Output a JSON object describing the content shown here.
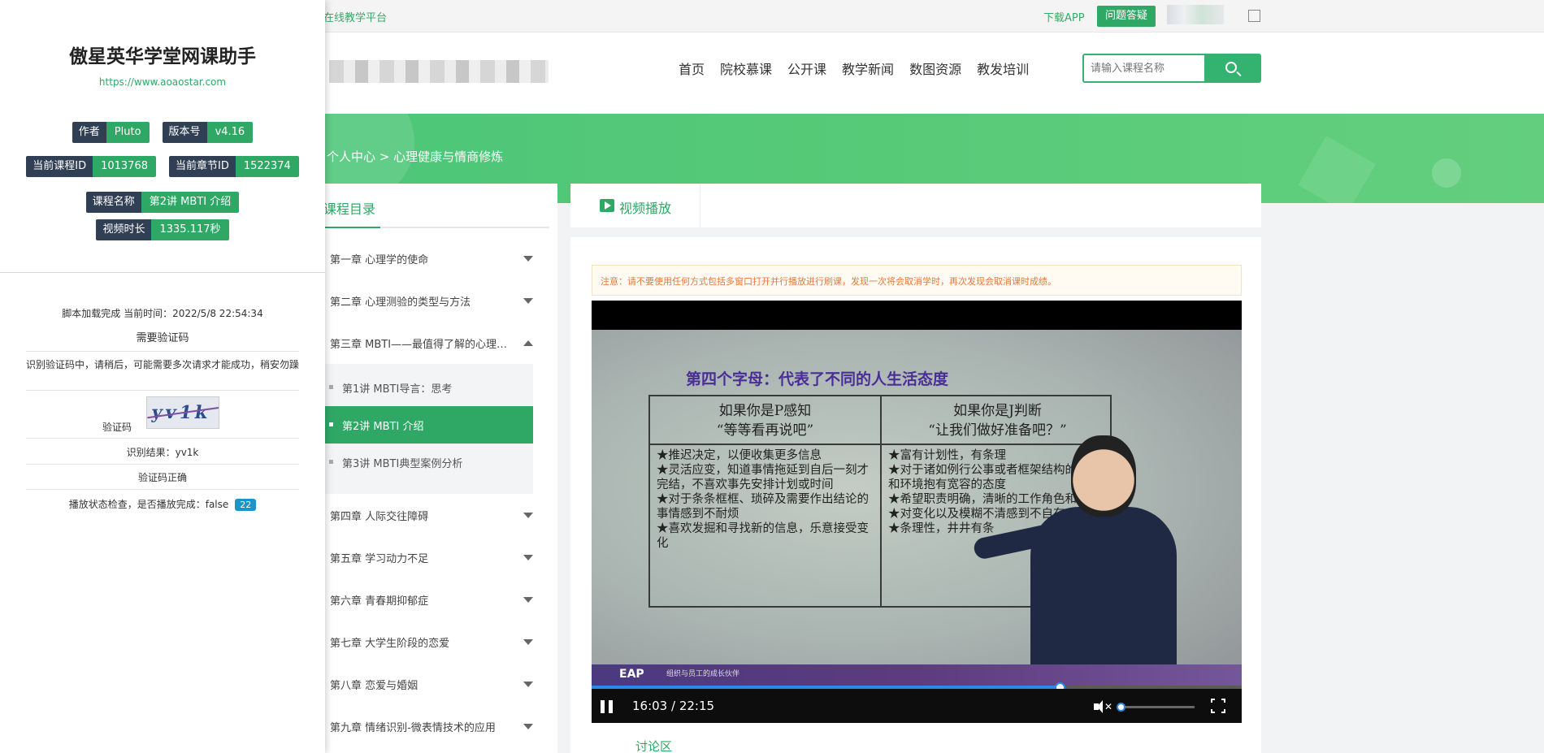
{
  "topbar": {
    "platform": "在线教学平台",
    "download": "下载APP",
    "qa": "问题答疑"
  },
  "nav": {
    "items": [
      "首页",
      "院校慕课",
      "公开课",
      "教学新闻",
      "数图资源",
      "教发培训"
    ],
    "search_placeholder": "请输入课程名称"
  },
  "breadcrumb": "个人中心 > 心理健康与情商修炼",
  "catalog": {
    "title": "课程目录",
    "chapters": [
      "第一章 心理学的使命",
      "第二章 心理测验的类型与方法",
      "第三章 MBTI——最值得了解的心理测验",
      "第四章 人际交往障碍",
      "第五章 学习动力不足",
      "第六章 青春期抑郁症",
      "第七章 大学生阶段的恋爱",
      "第八章 恋爱与婚姻",
      "第九章 情绪识别-微表情技术的应用"
    ],
    "lessons": [
      "第1讲 MBTI导言：思考",
      "第2讲 MBTI 介绍",
      "第3讲 MBTI典型案例分析"
    ],
    "active_lesson": 1
  },
  "player": {
    "tab": "视频播放",
    "notice": "注意：请不要使用任何方式包括多窗口打开并行播放进行刷课，发现一次将会取消学时，再次发现会取消课时成绩。",
    "time": "16:03 / 22:15",
    "progress": 0.72,
    "volume": 0.0,
    "discussion": "讨论区"
  },
  "slide": {
    "title": "第四个字母：代表了不同的人生活态度",
    "left_head_1": "如果你是P感知",
    "left_head_2": "“等等看再说吧”",
    "right_head_1": "如果你是J判断",
    "right_head_2": "“让我们做好准备吧？”",
    "left_items": [
      "★推迟决定，以便收集更多信息",
      "★灵活应变，知道事情拖延到自后一刻才完结，不喜欢事先安排计划或时间",
      "★对于条条框框、琐碎及需要作出结论的事情感到不耐烦",
      "★喜欢发掘和寻找新的信息，乐意接受变化"
    ],
    "right_items": [
      "★富有计划性，有条理",
      "★对于诸如例行公事或者框架结构的事务和环境抱有宽容的态度",
      "★希望职责明确，清晰的工作角色和任务",
      "★对变化以及模糊不清感到不自在",
      "★条理性，井井有条"
    ],
    "footer_logo": "EAP",
    "footer_text": "组织与员工的成长伙伴"
  },
  "helper": {
    "title": "傲星英华学堂网课助手",
    "url": "https://www.aoaostar.com",
    "author_k": "作者",
    "author_v": "Pluto",
    "version_k": "版本号",
    "version_v": "v4.16",
    "course_id_k": "当前课程ID",
    "course_id_v": "1013768",
    "chapter_id_k": "当前章节ID",
    "chapter_id_v": "1522374",
    "course_name_k": "课程名称",
    "course_name_v": "第2讲 MBTI 介绍",
    "duration_k": "视频时长",
    "duration_v": "1335.117秒",
    "loaded": "脚本加载完成 当前时间：2022/5/8 22:54:34",
    "need_captcha": "需要验证码",
    "recognizing": "识别验证码中，请稍后，可能需要多次请求才能成功，稍安勿躁",
    "captcha_label": "验证码",
    "captcha_text": "yv1k",
    "result": "识别结果：yv1k",
    "correct": "验证码正确",
    "status": "播放状态检查，是否播放完成：false",
    "status_count": "22"
  },
  "colors": {
    "accent": "#2fa866",
    "badge_dark": "#303f54",
    "progress": "#2b8ae6"
  }
}
